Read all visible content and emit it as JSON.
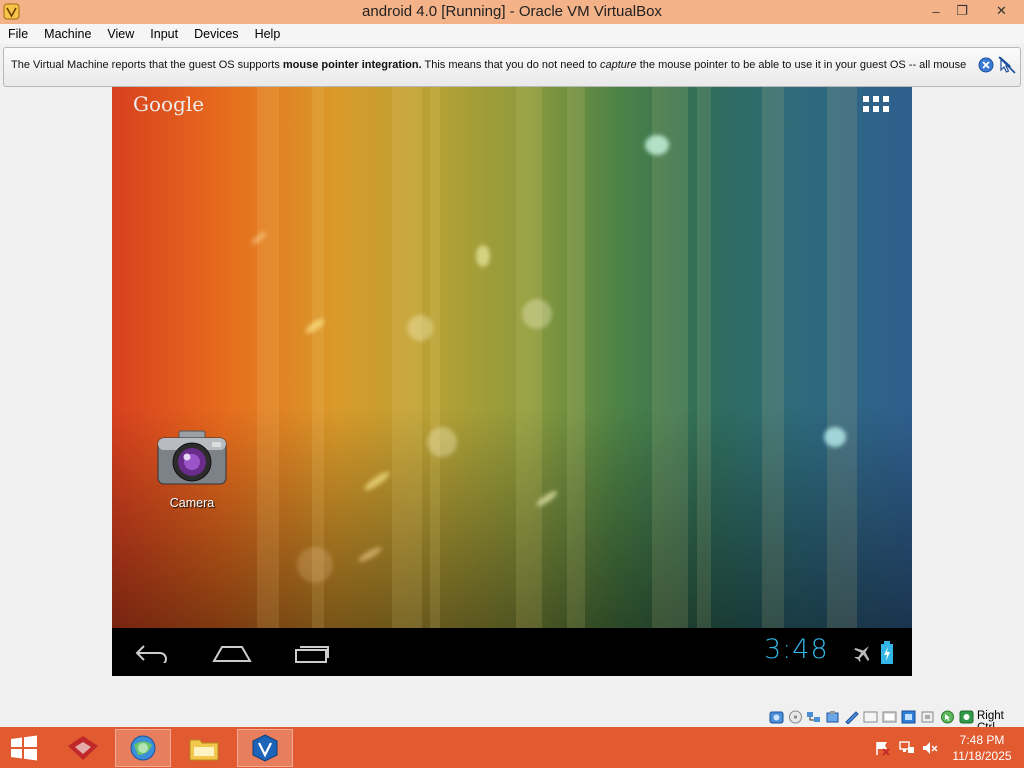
{
  "window": {
    "title": "android 4.0 [Running] - Oracle VM VirtualBox",
    "icon": "virtualbox-app-icon",
    "controls": {
      "minimize": "–",
      "maximize": "❐",
      "close": "✕"
    }
  },
  "menu": {
    "items": [
      "File",
      "Machine",
      "View",
      "Input",
      "Devices",
      "Help"
    ]
  },
  "banner": {
    "text_prefix": "The Virtual Machine reports that the guest OS supports ",
    "text_bold": "mouse pointer integration.",
    "text_middle": " This means that you do not need to ",
    "text_italic": "capture",
    "text_suffix": " the mouse pointer to be able to use it in your guest OS -- all mouse",
    "close_icon": "close-icon",
    "disable_icon": "do-not-show-again-icon"
  },
  "guest": {
    "google_label": "Google",
    "apps_icon": "app-drawer-grid-icon",
    "desktop_icon": {
      "label": "Camera",
      "icon": "camera-icon"
    },
    "navbar": {
      "back_icon": "back-icon",
      "home_icon": "home-icon",
      "recents_icon": "recent-apps-icon",
      "clock": "3:48",
      "airplane_icon": "airplane-mode-icon",
      "battery_icon": "battery-charging-icon",
      "accent": "#33b5e5"
    }
  },
  "statusbar": {
    "icons": [
      "hard-disk-icon",
      "optical-drive-icon",
      "network-icon",
      "usb-icon",
      "shared-folders-icon",
      "display-icon",
      "video-capture-icon",
      "virtualization-icon",
      "mouse-integration-icon",
      "keyboard-capture-icon"
    ],
    "host_key": "Right Ctrl"
  },
  "taskbar": {
    "start_icon": "windows-start-icon",
    "apps": [
      "app-icon",
      "browser-icon",
      "file-explorer-icon",
      "virtualbox-icon"
    ],
    "tray": [
      "action-center-flag-icon",
      "network-tray-icon",
      "volume-muted-icon"
    ],
    "time": "7:48 PM",
    "date": "11/18/2025",
    "color": "#e15a30"
  }
}
